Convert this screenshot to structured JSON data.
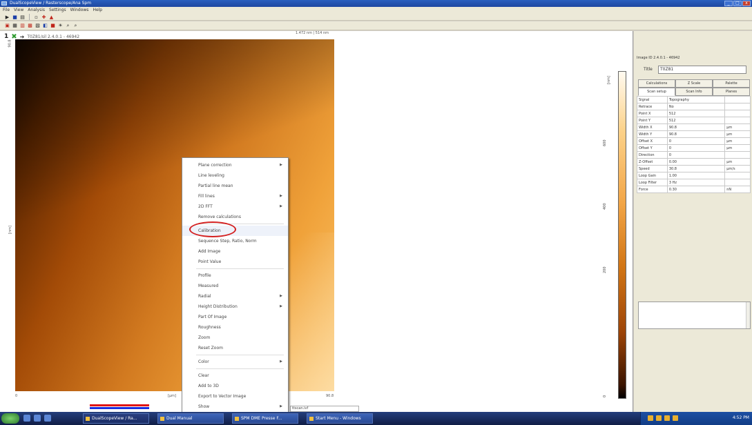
{
  "window": {
    "title": "DualScopeView / Rasterscope/Ana Spm",
    "buttons": {
      "minimize": "_",
      "maximize": "□",
      "close": "x"
    }
  },
  "menubar": [
    "File",
    "View",
    "Analysis",
    "Settings",
    "Windows",
    "Help"
  ],
  "image_header": {
    "number": "1",
    "label": "T0Z81/sil 2.4.0.1 - 46942"
  },
  "scan": {
    "dimension_label": "1.472 nm | 514 nm",
    "y_axis_label": "[nm]",
    "x_axis_unit": "[µm]",
    "x_ticks": [
      "0",
      "90.8"
    ],
    "y_tick_top": "90.8"
  },
  "colorscale": {
    "unit": "[nm]",
    "ticks": [
      "600",
      "400",
      "200",
      "0"
    ]
  },
  "right_panel": {
    "image_id_label": "Image ID 2.4.0.1 - 46942",
    "title_label": "Title",
    "title_value": "T0Z81",
    "tabs": [
      "Calculations",
      "Z Scale",
      "Palette",
      "Scan setup",
      "Scan Info",
      "Planes"
    ],
    "properties": [
      {
        "key": "Signal",
        "value": "Topography",
        "unit": ""
      },
      {
        "key": "Retrace",
        "value": "No",
        "unit": ""
      },
      {
        "key": "Point X",
        "value": "512",
        "unit": ""
      },
      {
        "key": "Point Y",
        "value": "512",
        "unit": ""
      },
      {
        "key": "Width X",
        "value": "90.8",
        "unit": "µm"
      },
      {
        "key": "Width Y",
        "value": "90.8",
        "unit": "µm"
      },
      {
        "key": "Offset X",
        "value": "0",
        "unit": "µm"
      },
      {
        "key": "Offset Y",
        "value": "0",
        "unit": "µm"
      },
      {
        "key": "Direction",
        "value": "0",
        "unit": ""
      },
      {
        "key": "Z-Offset",
        "value": "0.00",
        "unit": "µm"
      },
      {
        "key": "Speed",
        "value": "30.8",
        "unit": "µm/s"
      },
      {
        "key": "Loop Gain",
        "value": "1.00",
        "unit": ""
      },
      {
        "key": "Loop Filter",
        "value": "3 Hz",
        "unit": ""
      },
      {
        "key": "Force",
        "value": "0.30",
        "unit": "nN"
      }
    ]
  },
  "context_menu": {
    "items": [
      {
        "label": "Plane correction",
        "submenu": true
      },
      {
        "label": "Line leveling",
        "submenu": false
      },
      {
        "label": "Partial line mean",
        "submenu": false
      },
      {
        "label": "Fill lines",
        "submenu": true
      },
      {
        "label": "2D FFT",
        "submenu": true
      },
      {
        "label": "Remove calculations",
        "submenu": false
      },
      {
        "sep": true
      },
      {
        "label": "Calibration",
        "submenu": false,
        "highlighted": true
      },
      {
        "label": "Sequence Step, Ratio, Norm",
        "submenu": false
      },
      {
        "label": "Add Image",
        "submenu": false
      },
      {
        "label": "Point Value",
        "submenu": false
      },
      {
        "sep": true
      },
      {
        "label": "Profile",
        "submenu": false
      },
      {
        "label": "Measured",
        "submenu": false
      },
      {
        "label": "Radial",
        "submenu": true
      },
      {
        "label": "Height Distribution",
        "submenu": true
      },
      {
        "label": "Part Of Image",
        "submenu": false
      },
      {
        "label": "Roughness",
        "submenu": false
      },
      {
        "label": "Zoom",
        "submenu": false
      },
      {
        "label": "Reset Zoom",
        "submenu": false
      },
      {
        "sep": true
      },
      {
        "label": "Color",
        "submenu": true
      },
      {
        "sep": true
      },
      {
        "label": "Clear",
        "submenu": false
      },
      {
        "label": "Add to 3D",
        "submenu": false
      },
      {
        "label": "Export to Vector Image",
        "submenu": false
      },
      {
        "label": "Show",
        "submenu": true
      }
    ],
    "submenu_glyph": "▶"
  },
  "status": {
    "fragment": "ttscan.ivf"
  },
  "taskbar": {
    "tasks": [
      "DualScopeView / Ra...",
      "Dual Manual",
      "SPM DME Presse F...",
      "Start Menu - Windows"
    ],
    "clock": "4:52 PM"
  },
  "colors": {
    "accent": "#2a5fbf",
    "callout": "#d41f1f",
    "bar_red": "#e01010",
    "bar_blue": "#1a2ee0"
  }
}
